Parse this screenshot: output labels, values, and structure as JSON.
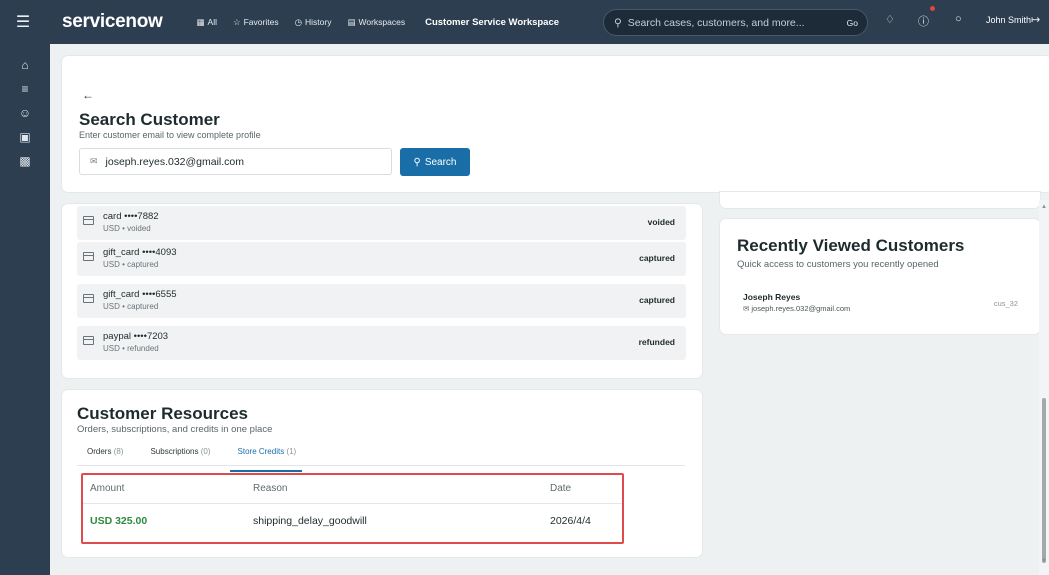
{
  "topbar": {
    "brand": "servicenow",
    "nav": [
      {
        "icon": "grid-icon",
        "label": "All"
      },
      {
        "icon": "star-icon",
        "label": "Favorites"
      },
      {
        "icon": "clock-icon",
        "label": "History"
      },
      {
        "icon": "workspace-icon",
        "label": "Workspaces"
      }
    ],
    "workspace_title": "Customer Service Workspace",
    "search_placeholder": "Search cases, customers, and more...",
    "search_go": "Go",
    "user_name": "John Smith"
  },
  "sidebar": {
    "items": [
      "home-icon",
      "list-icon",
      "users-icon",
      "cart-icon",
      "card-icon"
    ]
  },
  "search_customer": {
    "title": "Search Customer",
    "subtitle": "Enter customer email to view complete profile",
    "email_value": "joseph.reyes.032@gmail.com",
    "search_button": "Search"
  },
  "payments": [
    {
      "method": "card",
      "masked": "••••7882",
      "meta": "USD • voided",
      "status": "voided"
    },
    {
      "method": "gift_card",
      "masked": "••••4093",
      "meta": "USD • captured",
      "status": "captured"
    },
    {
      "method": "gift_card",
      "masked": "••••6555",
      "meta": "USD • captured",
      "status": "captured"
    },
    {
      "method": "paypal",
      "masked": "••••7203",
      "meta": "USD • refunded",
      "status": "refunded"
    }
  ],
  "recently_viewed": {
    "title": "Recently Viewed Customers",
    "subtitle": "Quick access to customers you recently opened",
    "customers": [
      {
        "name": "Joseph Reyes",
        "email": "joseph.reyes.032@gmail.com",
        "id": "cus_32"
      }
    ]
  },
  "resources": {
    "title": "Customer Resources",
    "subtitle": "Orders, subscriptions, and credits in one place",
    "tabs": [
      {
        "label": "Orders",
        "count": "(8)",
        "active": false
      },
      {
        "label": "Subscriptions",
        "count": "(0)",
        "active": false
      },
      {
        "label": "Store Credits",
        "count": "(1)",
        "active": true
      }
    ],
    "columns": [
      "Amount",
      "Reason",
      "Date"
    ],
    "rows": [
      {
        "amount": "USD 325.00",
        "reason": "shipping_delay_goodwill",
        "date": "2026/4/4"
      }
    ]
  },
  "colors": {
    "nav_bg": "#2d3e50",
    "accent": "#1a6ea8",
    "credit_green": "#2e8b3e",
    "highlight_red": "#e04a4a"
  }
}
